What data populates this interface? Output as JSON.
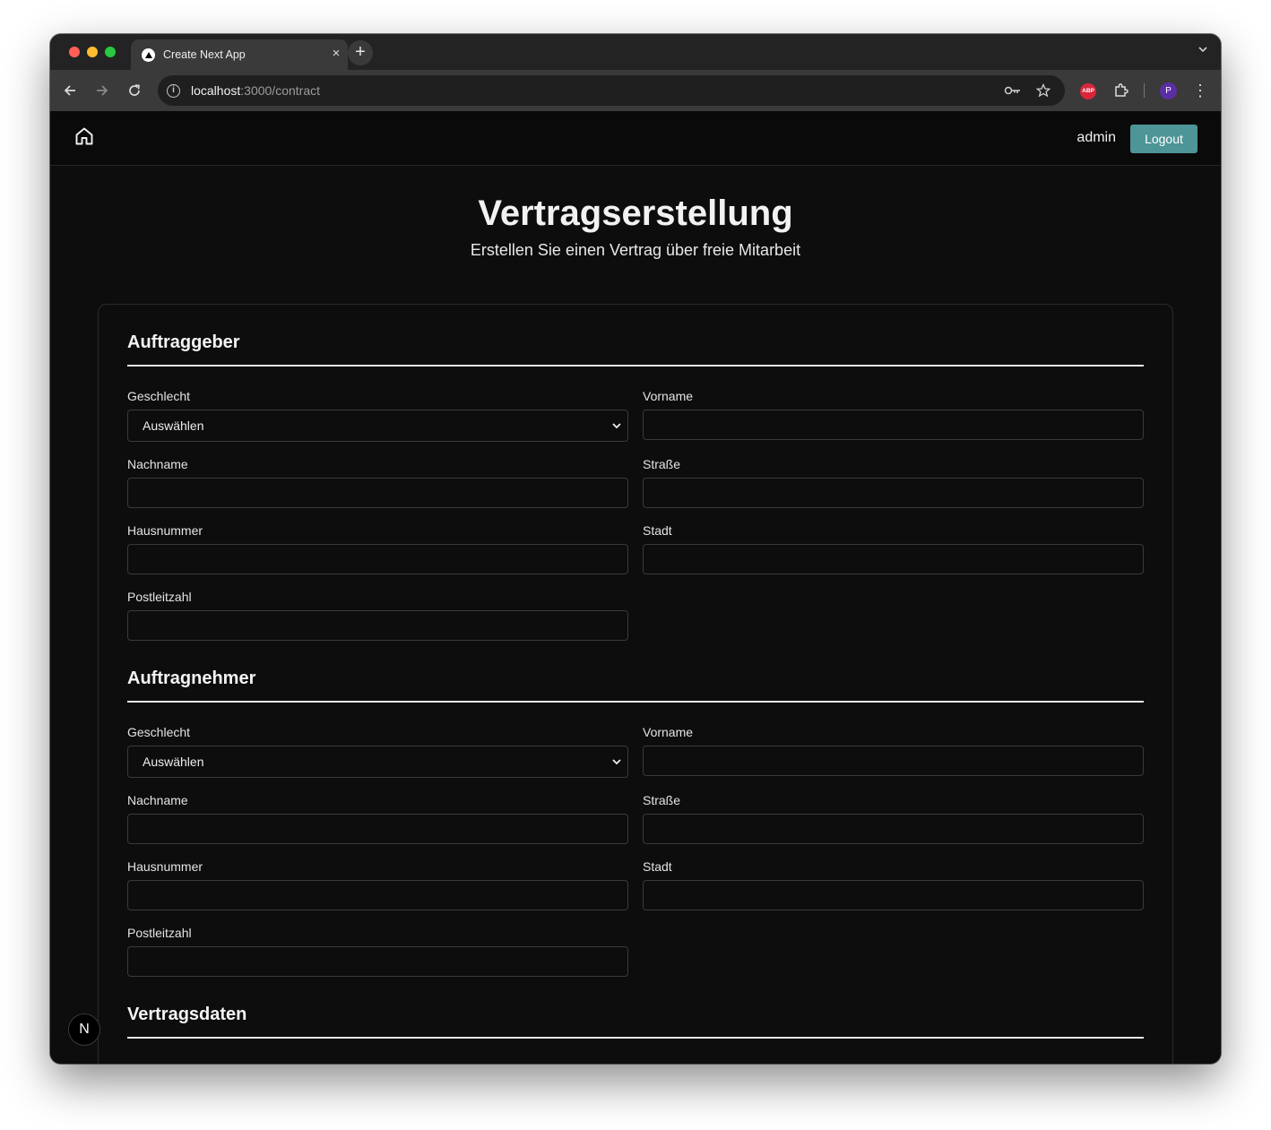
{
  "browser": {
    "tab_title": "Create Next App",
    "tab_close": "×",
    "new_tab": "+",
    "url_host": "localhost",
    "url_rest": ":3000/contract"
  },
  "navbar": {
    "user": "admin",
    "logout_label": "Logout"
  },
  "header": {
    "title": "Vertragserstellung",
    "subtitle": "Erstellen Sie einen Vertrag über freie Mitarbeit"
  },
  "sections": {
    "client": {
      "title": "Auftraggeber",
      "gender_label": "Geschlecht",
      "gender_selected": "Auswählen",
      "firstname_label": "Vorname",
      "lastname_label": "Nachname",
      "street_label": "Straße",
      "housenumber_label": "Hausnummer",
      "city_label": "Stadt",
      "zip_label": "Postleitzahl"
    },
    "contractor": {
      "title": "Auftragnehmer",
      "gender_label": "Geschlecht",
      "gender_selected": "Auswählen",
      "firstname_label": "Vorname",
      "lastname_label": "Nachname",
      "street_label": "Straße",
      "housenumber_label": "Hausnummer",
      "city_label": "Stadt",
      "zip_label": "Postleitzahl"
    },
    "contract": {
      "title": "Vertragsdaten"
    }
  },
  "dev_badge": "N",
  "colors": {
    "accent": "#4e9597",
    "background": "#0d0d0d"
  }
}
